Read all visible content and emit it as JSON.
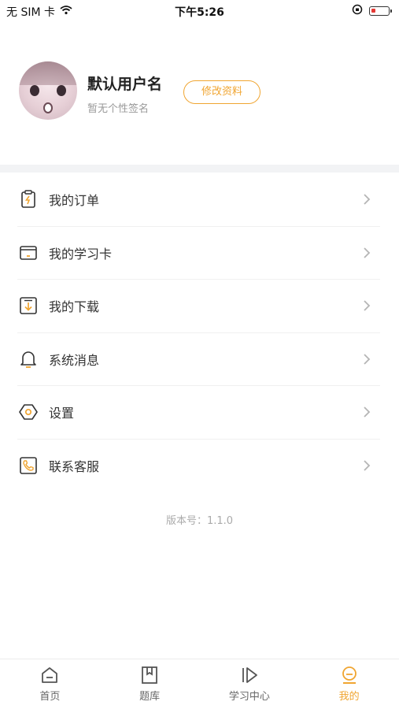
{
  "status_bar": {
    "carrier": "无 SIM 卡",
    "time": "下午5:26"
  },
  "profile": {
    "username": "默认用户名",
    "signature": "暂无个性签名",
    "edit_label": "修改资料"
  },
  "menu": {
    "items": [
      {
        "label": "我的订单",
        "icon": "order-clipboard-icon"
      },
      {
        "label": "我的学习卡",
        "icon": "card-icon"
      },
      {
        "label": "我的下载",
        "icon": "download-icon"
      },
      {
        "label": "系统消息",
        "icon": "bell-icon"
      },
      {
        "label": "设置",
        "icon": "settings-hexagon-icon"
      },
      {
        "label": "联系客服",
        "icon": "phone-icon"
      }
    ]
  },
  "version": "版本号：1.1.0",
  "tabbar": {
    "items": [
      {
        "label": "首页",
        "icon": "home-icon",
        "active": false
      },
      {
        "label": "题库",
        "icon": "bookmark-icon",
        "active": false
      },
      {
        "label": "学习中心",
        "icon": "play-icon",
        "active": false
      },
      {
        "label": "我的",
        "icon": "profile-icon",
        "active": true
      }
    ]
  },
  "colors": {
    "accent": "#f0a531",
    "band": "#f2f3f5"
  }
}
